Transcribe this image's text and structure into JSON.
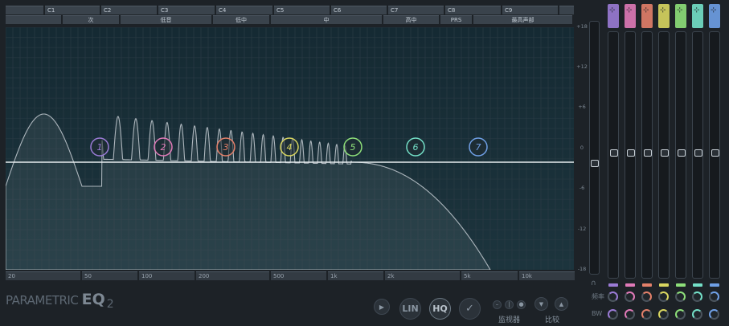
{
  "top_notes": [
    "",
    "C1",
    "C2",
    "C3",
    "C4",
    "C5",
    "C6",
    "C7",
    "C8",
    "C9",
    ""
  ],
  "top_ranges": [
    "",
    "次",
    "低音",
    "低中",
    "中",
    "高中",
    "PRS",
    "最高声部"
  ],
  "freq_labels": [
    "20",
    "50",
    "100",
    "200",
    "500",
    "1k",
    "2k",
    "5k",
    "10k"
  ],
  "db_labels": [
    "+18",
    "+12",
    "+6",
    "0",
    "-6",
    "-12",
    "-18"
  ],
  "bands": [
    {
      "num": "1",
      "color": "#9b7bd6"
    },
    {
      "num": "2",
      "color": "#e07ab8"
    },
    {
      "num": "3",
      "color": "#e3806a"
    },
    {
      "num": "4",
      "color": "#d9d660"
    },
    {
      "num": "5",
      "color": "#8ee07a"
    },
    {
      "num": "6",
      "color": "#74e0c8"
    },
    {
      "num": "7",
      "color": "#6fa0e6"
    }
  ],
  "side_labels": {
    "freq": "频率",
    "bw": "BW"
  },
  "brand": {
    "main": "PARAMETRIC ",
    "eq": "EQ",
    "ver": "2"
  },
  "buttons": {
    "lin": "LIN",
    "hq": "HQ"
  },
  "monitor_label": "监视器",
  "compare_label": "比较",
  "colors": {
    "curve": "#cfd6dc",
    "grid": "#2a3a44",
    "background": "#1d2227"
  }
}
